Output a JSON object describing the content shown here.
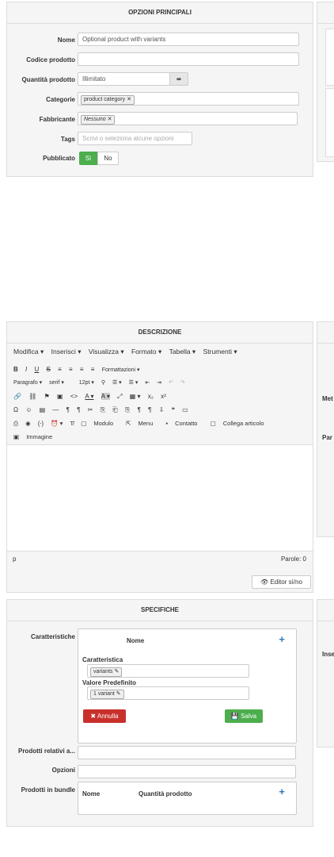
{
  "opzioni": {
    "title": "OPZIONI PRINCIPALI",
    "nome_label": "Nome",
    "nome_value": "Optional product with variants",
    "codice_label": "Codice prodotto",
    "codice_value": "",
    "quantita_label": "Quantità prodotto",
    "quantita_value": "Illimitato",
    "quantita_btn": "∞",
    "categorie_label": "Categorie",
    "categorie_tag": "product category",
    "fabbricante_label": "Fabbricante",
    "fabbricante_tag": "Nessuno",
    "tags_label": "Tags",
    "tags_placeholder": "Scrivi o seleziona alcune opzioni",
    "pubblicato_label": "Pubblicato",
    "si_label": "Sì",
    "no_label": "No"
  },
  "descrizione": {
    "title": "DESCRIZIONE",
    "menu": [
      "Modifica ▾",
      "Inserisci ▾",
      "Visualizza ▾",
      "Formato ▾",
      "Tabella ▾",
      "Strumenti ▾"
    ],
    "toolbar1": [
      "B",
      "I",
      "U",
      "S",
      "≡",
      "≡",
      "≡",
      "≡",
      "Formattazioni ▾"
    ],
    "toolbar2": [
      "Paragrafo  ▾",
      "serif  ▾",
      "12pt  ▾",
      "⚲",
      "☰ ▾",
      "☰ ▾",
      "⇤",
      "⇥",
      "↶",
      "↷"
    ],
    "toolbar3": [
      "🔗",
      "⛓",
      "⚑",
      "▣",
      "<>",
      "A ▾",
      "A ▾",
      "⤢",
      "▦ ▾",
      "x₂",
      "x²"
    ],
    "toolbar4": [
      "Ω",
      "☺",
      "▤",
      "—",
      "¶",
      "¶",
      "✂",
      "⎘",
      "⎗",
      "⎘",
      "¶",
      "¶",
      "⇩",
      "❝",
      "▭"
    ],
    "toolbar5_icons": [
      "⎙",
      "◉",
      "{⋅}",
      "⏰ ▾",
      "T̸"
    ],
    "modulo": "Modulo",
    "menu_btn": "Menu",
    "contatto": "Contatto",
    "collega": "Collega articolo",
    "immagine": "Immagine",
    "status_path": "p",
    "parole": "Parole: 0",
    "editor_toggle": "Editor sì/no"
  },
  "specifiche": {
    "title": "SPECIFICHE",
    "caratteristiche_label": "Caratteristiche",
    "nome_header": "Nome",
    "plus": "+",
    "caratteristica_label": "Caratteristica",
    "caratteristica_tag": "variants ✎",
    "valore_label": "Valore Predefinito",
    "valore_tag": "1 variant ✎",
    "annulla": "✖ Annulla",
    "salva": "💾 Salva",
    "prodotti_relativi_label": "Prodotti relativi a...",
    "opzioni_label": "Opzioni",
    "bundle_label": "Prodotti in bundle",
    "bundle_nome": "Nome",
    "bundle_quantita": "Quantità prodotto",
    "bundle_plus": "+"
  },
  "side": {
    "label1": "Met",
    "label2": "Par",
    "label3": "Inse"
  },
  "colors": {
    "green": "#4cae4c",
    "red": "#c9302c",
    "panel_bg": "#f5f5f5"
  }
}
